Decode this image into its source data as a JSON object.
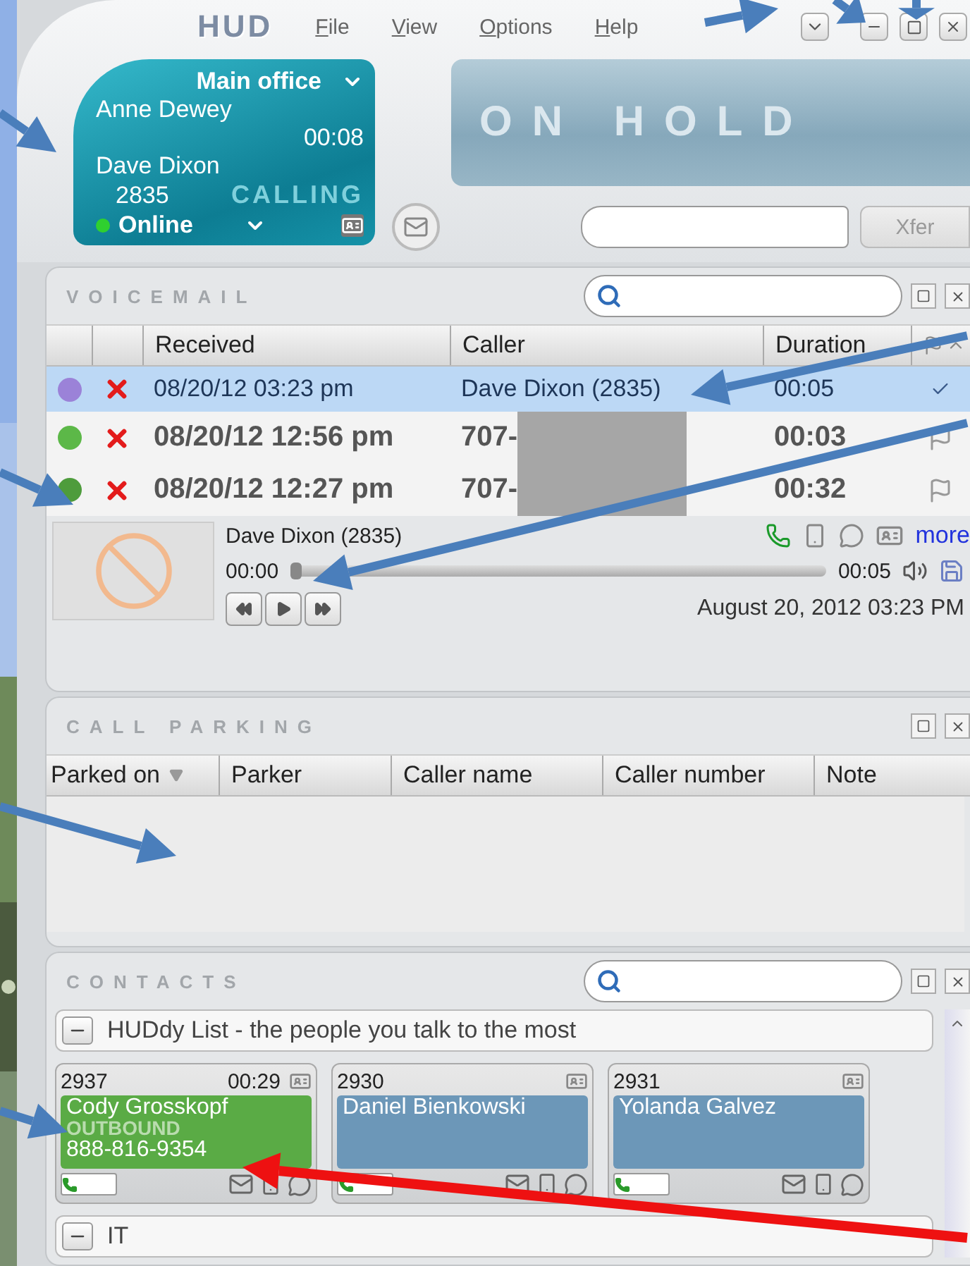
{
  "menu_bar": {
    "logo": "HUD",
    "menus": [
      {
        "label": "File"
      },
      {
        "label": "View"
      },
      {
        "label": "Options"
      },
      {
        "label": "Help"
      }
    ]
  },
  "status_panel": {
    "location": "Main office",
    "contact": "Anne Dewey",
    "timer": "00:08",
    "caller": "Dave Dixon",
    "extension": "2835",
    "state": "CALLING",
    "presence": "Online"
  },
  "hold_panel": {
    "label": "ON HOLD"
  },
  "transfer": {
    "button": "Xfer"
  },
  "voicemail": {
    "title": "VOICEMAIL",
    "columns": [
      "Received",
      "Caller",
      "Duration"
    ],
    "rows": [
      {
        "received": "08/20/12 03:23 pm",
        "caller": "Dave Dixon (2835)",
        "duration": "00:05",
        "selected": true,
        "unread": false,
        "color": "#9b82d8"
      },
      {
        "received": "08/20/12 12:56 pm",
        "caller": "707-",
        "duration": "00:03",
        "selected": false,
        "unread": true,
        "color": "#5cb848"
      },
      {
        "received": "08/20/12 12:27 pm",
        "caller": "707-",
        "duration": "00:32",
        "selected": false,
        "unread": true,
        "color": "#4e9c3c"
      }
    ],
    "player": {
      "caller": "Dave Dixon (2835)",
      "link": "more",
      "elapsed": "00:00",
      "total": "00:05",
      "level": 0,
      "date": "August 20, 2012 03:23 PM"
    }
  },
  "call_parking": {
    "title": "CALL PARKING",
    "columns": [
      "Parked on",
      "Parker",
      "Caller name",
      "Caller number",
      "Note"
    ]
  },
  "contacts": {
    "title": "CONTACTS",
    "groups": [
      {
        "label": "HUDdy List - the people you talk to the most",
        "expanded": true,
        "cards": [
          {
            "extension": "2937",
            "timer": "00:29",
            "name": "Cody Grosskopf",
            "state": "OUTBOUND",
            "number": "888-816-9354",
            "color": "#5aab45"
          },
          {
            "extension": "2930",
            "name": "Daniel Bienkowski",
            "color": "#6c97b8"
          },
          {
            "extension": "2931",
            "name": "Yolanda Galvez",
            "color": "#6c97b8"
          }
        ]
      },
      {
        "label": "IT",
        "expanded": true
      }
    ]
  }
}
